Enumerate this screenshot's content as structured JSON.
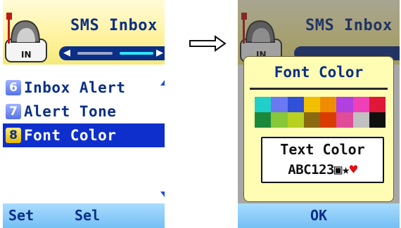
{
  "left_screen": {
    "header": {
      "title": "SMS Inbox",
      "icon": "inbox-mailbox-icon",
      "icon_label": "IN"
    },
    "tab_strip": {
      "left_arrow": "◀",
      "right_arrow": "▶",
      "active_segment_color": "#2ee6ff",
      "inactive_segment_color": "#9aa7c9"
    },
    "menu": {
      "items": [
        {
          "number": "6",
          "label": "Inbox Alert",
          "selected": false
        },
        {
          "number": "7",
          "label": "Alert Tone",
          "selected": false
        },
        {
          "number": "8",
          "label": "Font Color",
          "selected": true
        }
      ]
    },
    "scroll": {
      "up_icon": "scroll-up-arrow-icon",
      "down_icon": "scroll-down-arrow-icon"
    },
    "softkeys": {
      "left": "Set",
      "right": "Sel"
    }
  },
  "transition": {
    "icon": "right-arrow-icon"
  },
  "right_screen": {
    "header": {
      "title": "SMS Inbox",
      "icon": "inbox-mailbox-icon",
      "icon_label": "IN"
    },
    "dialog": {
      "title": "Font Color",
      "palette": {
        "colors": [
          "#20d0c8",
          "#6a78f2",
          "#3050d8",
          "#f0c000",
          "#f08c00",
          "#b040e0",
          "#f040b8",
          "#e01838",
          "#1a8a3a",
          "#88c838",
          "#b8d020",
          "#8a6a10",
          "#d83c00",
          "#e04c98",
          "#c0c0c0",
          "#101010"
        ],
        "selected_index": 15
      },
      "preview": {
        "title": "Text Color",
        "sample_text": "ABC123",
        "symbols": {
          "square": "▣",
          "star": "★",
          "heart": "♥"
        }
      }
    },
    "softkeys": {
      "center": "OK"
    }
  },
  "colors": {
    "header_bg": "#fff3a0",
    "menu_text": "#0b2f86",
    "selection_bg": "#0f2fcc",
    "softkey_bg": "#86c9f6",
    "dialog_bg": "#fffcb4"
  }
}
